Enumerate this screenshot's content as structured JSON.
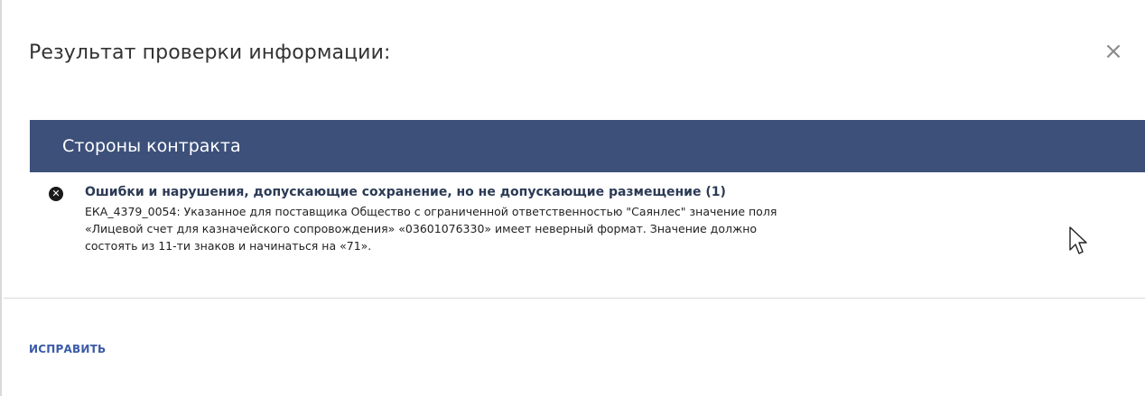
{
  "dialog": {
    "title": "Результат проверки информации:",
    "close_glyph": "×"
  },
  "section": {
    "title": "Стороны контракта"
  },
  "message": {
    "icon": "error-circle-x-icon",
    "icon_glyph": "✕",
    "title": "Ошибки и нарушения, допускающие сохранение, но не допускающие размещение (1)",
    "lines": [
      "ЕКА_4379_0054: Указанное для поставщика Общество с ограниченной ответственностью \"Саянлес\" значение поля",
      "«Лицевой счет для казначейского сопровождения» «03601076330» имеет неверный формат. Значение должно",
      "состоять из 11-ти знаков и начинаться на «71»."
    ]
  },
  "actions": {
    "fix_label": "ИСПРАВИТЬ"
  },
  "colors": {
    "header_bg": "#3c507a",
    "link": "#3a5aa8",
    "title_text": "#2b3a55"
  }
}
